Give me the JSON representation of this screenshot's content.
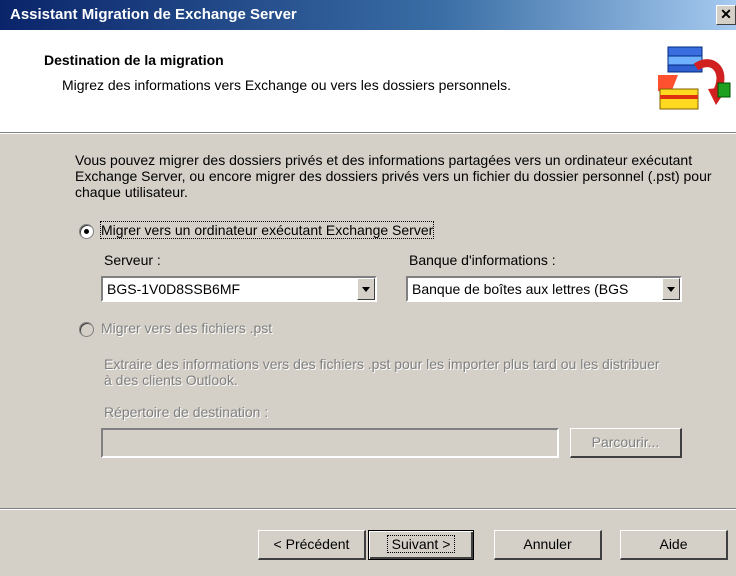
{
  "window": {
    "title": "Assistant Migration de Exchange Server",
    "close_label": "✕"
  },
  "header": {
    "title": "Destination de la migration",
    "subtitle": "Migrez des informations vers Exchange ou vers les dossiers personnels.",
    "icon": "migration-wizard-icon"
  },
  "description": "Vous pouvez migrer des dossiers privés et des informations partagées vers un ordinateur exécutant Exchange Server, ou encore migrer des dossiers privés vers un fichier du dossier personnel (.pst) pour chaque utilisateur.",
  "option_exchange": {
    "label": "Migrer vers un ordinateur exécutant Exchange Server",
    "selected": true,
    "server_label": "Serveur :",
    "server_value": "BGS-1V0D8SSB6MF",
    "store_label": "Banque d'informations :",
    "store_value": "Banque de boîtes aux lettres (BGS"
  },
  "option_pst": {
    "label": "Migrer vers des fichiers .pst",
    "selected": false,
    "description": "Extraire des informations vers des fichiers .pst pour les importer plus tard ou les distribuer à des clients Outlook.",
    "dest_label": "Répertoire de destination :",
    "dest_value": "",
    "browse_label": "Parcourir..."
  },
  "footer": {
    "back_label": "< Précédent",
    "next_label": "Suivant >",
    "cancel_label": "Annuler",
    "help_label": "Aide"
  }
}
